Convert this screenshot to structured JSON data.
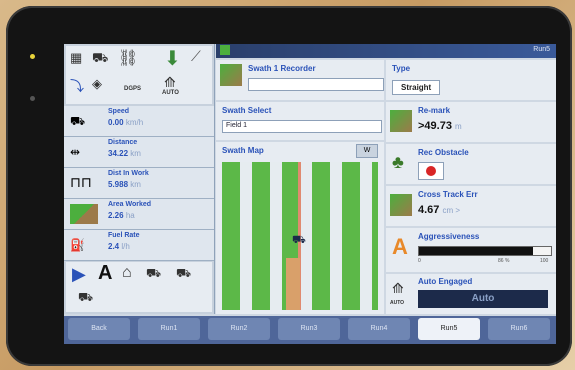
{
  "header": {
    "page_label": "Run5"
  },
  "left_panel": {
    "icon_row": {
      "dgps_label": "DGPS",
      "auto_label": "AUTO"
    },
    "speed": {
      "label": "Speed",
      "value": "0.00",
      "unit": "km/h"
    },
    "distance": {
      "label": "Distance",
      "value": "34.22",
      "unit": "km"
    },
    "dist_in_work": {
      "label": "Dist In Work",
      "value": "5.988",
      "unit": "km"
    },
    "area_worked": {
      "label": "Area Worked",
      "value": "2.26",
      "unit": "ha"
    },
    "fuel_rate": {
      "label": "Fuel Rate",
      "value": "2.4",
      "unit": "l/h"
    }
  },
  "recorder": {
    "title": "Swath 1 Recorder",
    "value": ""
  },
  "type": {
    "title": "Type",
    "value": "Straight"
  },
  "swath_select": {
    "title": "Swath Select",
    "value": "Field 1"
  },
  "swath_map": {
    "title": "Swath Map",
    "zoom_button": "W"
  },
  "remark": {
    "title": "Re-mark",
    "value": ">49.73",
    "unit": "m"
  },
  "rec_obstacle": {
    "title": "Rec Obstacle"
  },
  "cross_track": {
    "title": "Cross Track Err",
    "value": "4.67",
    "unit": "cm >"
  },
  "aggressiveness": {
    "title": "Aggressiveness",
    "ticks": [
      "0",
      "86 %",
      "100"
    ],
    "level_fraction": 0.86
  },
  "auto_engaged": {
    "title": "Auto Engaged",
    "value": "Auto",
    "icon_label": "AUTO"
  },
  "tabs": [
    {
      "label": "Back"
    },
    {
      "label": "Run1"
    },
    {
      "label": "Run2"
    },
    {
      "label": "Run3"
    },
    {
      "label": "Run4"
    },
    {
      "label": "Run5"
    },
    {
      "label": "Run6"
    }
  ],
  "colors": {
    "accent": "#2a52b8",
    "header": "#3a5a9a",
    "field_green": "#5cb848",
    "record_red": "#d92626"
  }
}
